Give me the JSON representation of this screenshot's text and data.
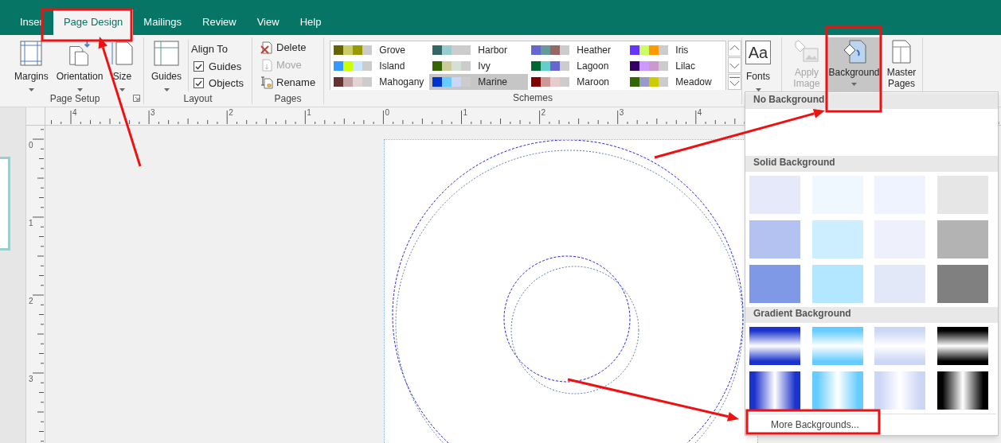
{
  "tabs": [
    {
      "label": "Inser",
      "selected": false
    },
    {
      "label": "Page Design",
      "selected": true
    },
    {
      "label": "Mailings",
      "selected": false
    },
    {
      "label": "Review",
      "selected": false
    },
    {
      "label": "View",
      "selected": false
    },
    {
      "label": "Help",
      "selected": false
    }
  ],
  "page_setup": {
    "title": "Page Setup",
    "buttons": [
      {
        "label": "Margins",
        "kind": "margins"
      },
      {
        "label": "Orientation",
        "kind": "orientation"
      },
      {
        "label": "Size",
        "kind": "size"
      }
    ]
  },
  "layout": {
    "title": "Layout",
    "guides_button": "Guides",
    "align_to": "Align To",
    "checkboxes": [
      {
        "label": "Guides",
        "checked": true
      },
      {
        "label": "Objects",
        "checked": true
      }
    ]
  },
  "pages": {
    "title": "Pages",
    "buttons": [
      {
        "label": "Delete",
        "kind": "delete",
        "disabled": false
      },
      {
        "label": "Move",
        "kind": "move",
        "disabled": true
      },
      {
        "label": "Rename",
        "kind": "rename",
        "disabled": false
      }
    ]
  },
  "schemes": {
    "title": "Schemes",
    "items": [
      {
        "name": "Grove",
        "swatches": [
          {
            "color": "#666600"
          },
          {
            "color": "#cccc66"
          },
          {
            "color": "#999900"
          },
          {
            "color": "#cccccc"
          }
        ],
        "selected": false
      },
      {
        "name": "Harbor",
        "swatches": [
          {
            "color": "#336666"
          },
          {
            "color": "#99cccc"
          },
          {
            "color": "#cccccc"
          },
          {
            "color": "#cccccc"
          }
        ],
        "selected": false
      },
      {
        "name": "Heather",
        "swatches": [
          {
            "color": "#6666cc"
          },
          {
            "color": "#669999"
          },
          {
            "color": "#996666"
          },
          {
            "color": "#cccccc"
          }
        ],
        "selected": false
      },
      {
        "name": "Iris",
        "swatches": [
          {
            "color": "#6633ff"
          },
          {
            "color": "#ccff66"
          },
          {
            "color": "#ff9900"
          },
          {
            "color": "#cccccc"
          }
        ],
        "selected": false
      },
      {
        "name": "Island",
        "swatches": [
          {
            "color": "#3399ff"
          },
          {
            "color": "#ccff00"
          },
          {
            "color": "#cce6ff"
          },
          {
            "color": "#cccccc"
          }
        ],
        "selected": false
      },
      {
        "name": "Ivy",
        "swatches": [
          {
            "color": "#336600"
          },
          {
            "color": "#cccc99"
          },
          {
            "color": "#d4e0d4"
          },
          {
            "color": "#cccccc"
          }
        ],
        "selected": false
      },
      {
        "name": "Lagoon",
        "swatches": [
          {
            "color": "#006633"
          },
          {
            "color": "#66cccc"
          },
          {
            "color": "#6666cc"
          },
          {
            "color": "#cccccc"
          }
        ],
        "selected": false
      },
      {
        "name": "Lilac",
        "swatches": [
          {
            "color": "#330066"
          },
          {
            "color": "#cc99ff"
          },
          {
            "color": "#cc99cc"
          },
          {
            "color": "#cccccc"
          }
        ],
        "selected": false
      },
      {
        "name": "Mahogany",
        "swatches": [
          {
            "color": "#663333"
          },
          {
            "color": "#c4a4a4"
          },
          {
            "color": "#e0d4d4"
          },
          {
            "color": "#cccccc"
          }
        ],
        "selected": false
      },
      {
        "name": "Marine",
        "swatches": [
          {
            "color": "#0033cc"
          },
          {
            "color": "#66ccff"
          },
          {
            "color": "#ccd6f5"
          },
          {
            "color": "#cccccc"
          }
        ],
        "selected": true
      },
      {
        "name": "Maroon",
        "swatches": [
          {
            "color": "#800000"
          },
          {
            "color": "#cc9999"
          },
          {
            "color": "#e6cccc"
          },
          {
            "color": "#cccccc"
          }
        ],
        "selected": false
      },
      {
        "name": "Meadow",
        "swatches": [
          {
            "color": "#336600"
          },
          {
            "color": "#9999cc"
          },
          {
            "color": "#cccc00"
          },
          {
            "color": "#cccccc"
          }
        ],
        "selected": false
      }
    ]
  },
  "fonts": {
    "label": "Fonts",
    "sample": "Aa"
  },
  "page_background": {
    "buttons": [
      {
        "label": "Apply Image",
        "kind": "apply-image",
        "disabled": true,
        "selected": false
      },
      {
        "label": "Background",
        "kind": "background",
        "disabled": false,
        "selected": true
      },
      {
        "label": "Master Pages",
        "kind": "master-pages",
        "disabled": false,
        "selected": false
      }
    ]
  },
  "ruler": {
    "horizontal": [
      "4",
      "3",
      "2",
      "1",
      "0",
      "1",
      "2",
      "3",
      "4"
    ],
    "vertical": [
      "0",
      "1",
      "2",
      "3"
    ]
  },
  "background_menu": {
    "sections": [
      {
        "heading": "No Background",
        "kind": "none"
      },
      {
        "heading": "Solid Background",
        "kind": "solid",
        "swatches": [
          {
            "color": "#e5e9f9"
          },
          {
            "color": "#f0f8ff"
          },
          {
            "color": "#eef3ff"
          },
          {
            "color": "#e6e6e6"
          },
          {
            "color": "#b3c2f0"
          },
          {
            "color": "#cdeeff"
          },
          {
            "color": "#eef0fc"
          },
          {
            "color": "#b3b3b3"
          },
          {
            "color": "#8099e6"
          },
          {
            "color": "#b3e6ff"
          },
          {
            "color": "#e3e8f8"
          },
          {
            "color": "#808080"
          }
        ]
      },
      {
        "heading": "Gradient Background",
        "kind": "gradient",
        "swatches": [
          {
            "color": "#1a33cc",
            "kind": "horizontal"
          },
          {
            "color": "#66ccff",
            "kind": "horizontal"
          },
          {
            "color": "#ccd6f5",
            "kind": "horizontal"
          },
          {
            "color": "#000000",
            "kind": "horizontal"
          },
          {
            "color": "#1a33cc",
            "kind": "vertical"
          },
          {
            "color": "#66ccff",
            "kind": "vertical"
          },
          {
            "color": "#ccd6f5",
            "kind": "vertical"
          },
          {
            "color": "#000000",
            "kind": "vertical"
          }
        ]
      }
    ],
    "more": "More Backgrounds..."
  }
}
